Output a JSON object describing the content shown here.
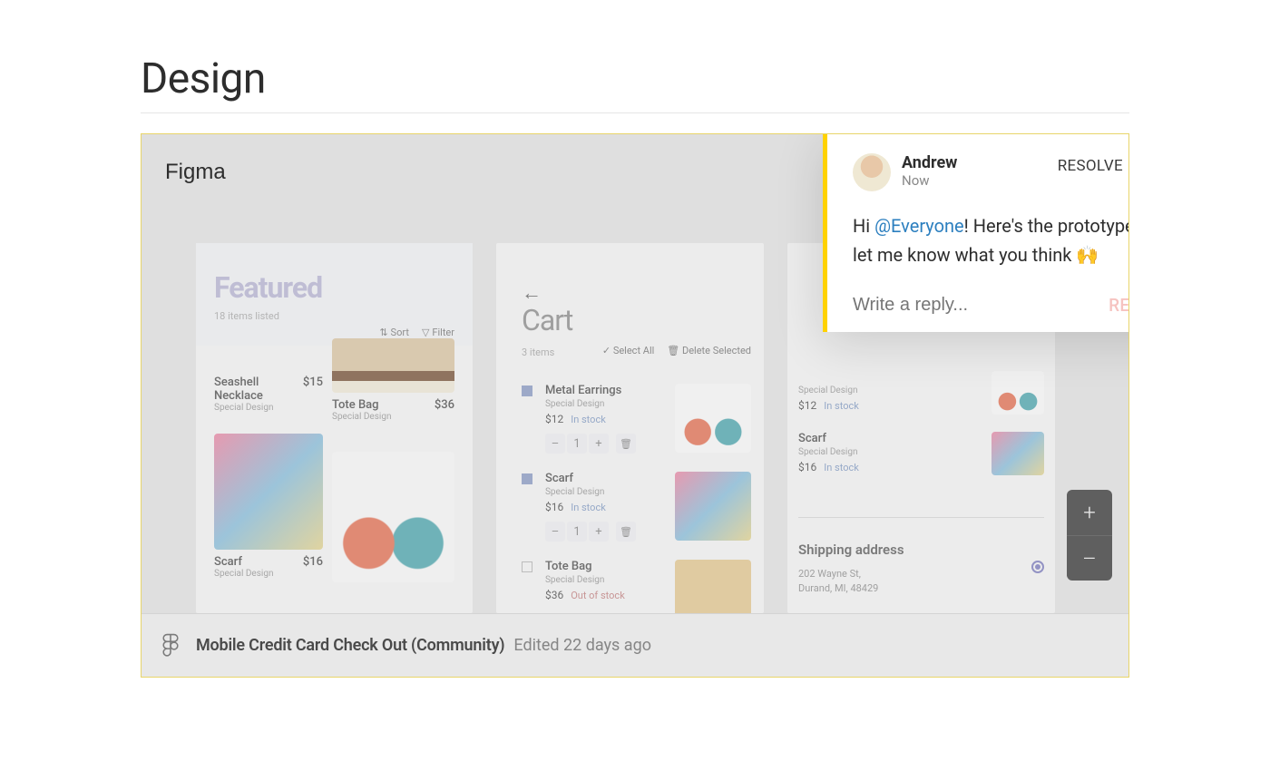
{
  "page": {
    "title": "Design"
  },
  "canvas": {
    "app_label": "Figma"
  },
  "featured_panel": {
    "title": "Featured",
    "subtitle": "18 items listed",
    "sort_label": "Sort",
    "filter_label": "Filter"
  },
  "products": {
    "seashell": {
      "name": "Seashell Necklace",
      "price": "$15",
      "sub": "Special Design"
    },
    "tote": {
      "name": "Tote Bag",
      "price": "$36",
      "sub": "Special Design"
    },
    "scarf": {
      "name": "Scarf",
      "price": "$16",
      "sub": "Special Design"
    }
  },
  "cart_panel": {
    "title": "Cart",
    "items_count": "3 items",
    "select_all": "Select All",
    "delete_selected": "Delete Selected",
    "qty_minus": "–",
    "qty_plus": "+",
    "qty_value": "1",
    "items": [
      {
        "name": "Metal Earrings",
        "sub": "Special Design",
        "price": "$12",
        "stock": "In stock",
        "checked": true
      },
      {
        "name": "Scarf",
        "sub": "Special Design",
        "price": "$16",
        "stock": "In stock",
        "checked": true
      },
      {
        "name": "Tote Bag",
        "sub": "Special Design",
        "price": "$36",
        "stock": "Out of stock",
        "checked": false
      }
    ]
  },
  "summary_panel": {
    "items": [
      {
        "name": "Special Design",
        "price": "$12",
        "stock": "In stock"
      },
      {
        "name": "Scarf",
        "sub": "Special Design",
        "price": "$16",
        "stock": "In stock"
      }
    ],
    "shipping_title": "Shipping address",
    "shipping_address_l1": "202 Wayne St,",
    "shipping_address_l2": "Durand, MI, 48429"
  },
  "bottom_bar": {
    "file_name": "Mobile Credit Card Check Out (Community)",
    "edited_label": "Edited 22 days ago"
  },
  "comment": {
    "author": "Andrew",
    "time": "Now",
    "resolve": "RESOLVE",
    "body_prefix": "Hi ",
    "mention": "@Everyone",
    "body_suffix": "! Here's the prototype, let me know what you think ",
    "emoji": "🙌",
    "reply_placeholder": "Write a reply...",
    "reply_button": "REPLY"
  },
  "zoom": {
    "in": "+",
    "out": "–"
  }
}
